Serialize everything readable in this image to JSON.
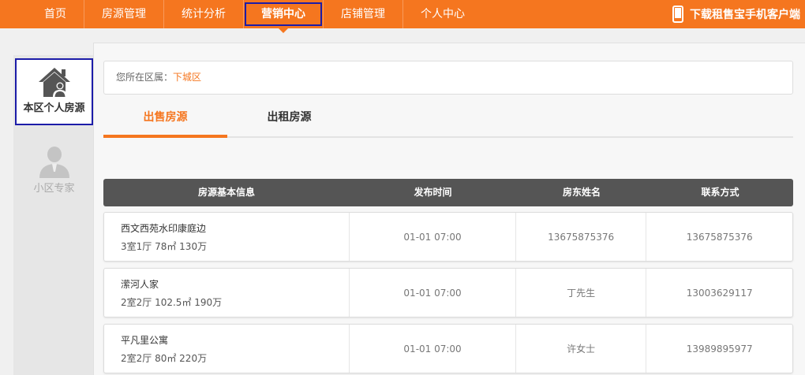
{
  "nav": {
    "items": [
      {
        "label": "首页"
      },
      {
        "label": "房源管理"
      },
      {
        "label": "统计分析"
      },
      {
        "label": "营销中心"
      },
      {
        "label": "店铺管理"
      },
      {
        "label": "个人中心"
      }
    ],
    "active_index": 3,
    "download_label": "下载租售宝手机客户端"
  },
  "sidebar": {
    "items": [
      {
        "label": "本区个人房源",
        "icon": "house-user-icon",
        "active": true
      },
      {
        "label": "小区专家",
        "icon": "person-icon",
        "active": false
      }
    ]
  },
  "region": {
    "prefix": "您所在区属：",
    "value": "下城区"
  },
  "tabs": [
    {
      "label": "出售房源",
      "active": true
    },
    {
      "label": "出租房源",
      "active": false
    }
  ],
  "table": {
    "headers": [
      "房源基本信息",
      "发布时间",
      "房东姓名",
      "联系方式"
    ],
    "rows": [
      {
        "name": "西文西苑水印康庭边",
        "spec": "3室1厅 78㎡ 130万",
        "time": "01-01 07:00",
        "owner": "13675875376",
        "contact": "13675875376"
      },
      {
        "name": "潆河人家",
        "spec": "2室2厅 102.5㎡ 190万",
        "time": "01-01 07:00",
        "owner": "丁先生",
        "contact": "13003629117"
      },
      {
        "name": "平凡里公寓",
        "spec": "2室2厅 80㎡ 220万",
        "time": "01-01 07:00",
        "owner": "许女士",
        "contact": "13989895977"
      }
    ]
  },
  "colors": {
    "accent": "#f5761f",
    "header_dark": "#555555",
    "highlight": "#1c1ca8"
  }
}
